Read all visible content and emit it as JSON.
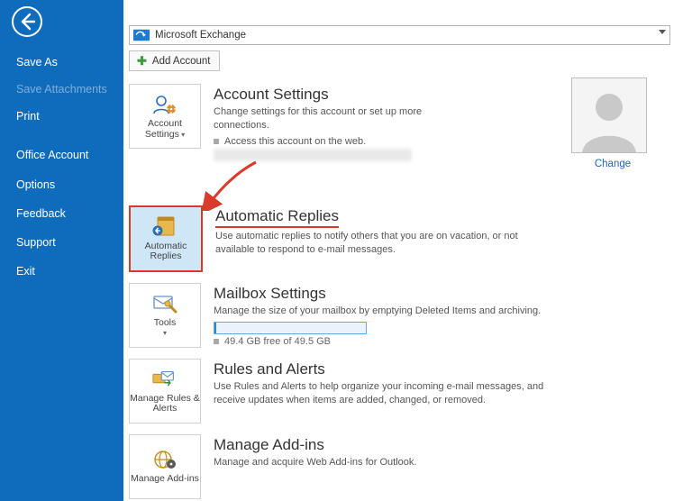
{
  "sidebar": {
    "items": [
      {
        "label": "Save As",
        "disabled": false
      },
      {
        "label": "Save Attachments",
        "disabled": true
      },
      {
        "label": "Print",
        "disabled": false
      }
    ],
    "items2": [
      {
        "label": "Office Account"
      },
      {
        "label": "Options"
      },
      {
        "label": "Feedback"
      },
      {
        "label": "Support"
      },
      {
        "label": "Exit"
      }
    ]
  },
  "account_selector": {
    "label": "Microsoft Exchange"
  },
  "add_account_btn": "Add Account",
  "avatar_change": "Change",
  "sections": {
    "account": {
      "tile_label": "Account Settings",
      "heading": "Account Settings",
      "desc": "Change settings for this account or set up more connections.",
      "sub": "Access this account on the web."
    },
    "auto": {
      "tile_label": "Automatic Replies",
      "heading": "Automatic Replies",
      "desc": "Use automatic replies to notify others that you are on vacation, or not available to respond to e-mail messages."
    },
    "mailbox": {
      "tile_label": "Tools",
      "heading": "Mailbox Settings",
      "desc": "Manage the size of your mailbox by emptying Deleted Items and archiving.",
      "storage_text": "49.4 GB free of 49.5 GB"
    },
    "rules": {
      "tile_label": "Manage Rules & Alerts",
      "heading": "Rules and Alerts",
      "desc": "Use Rules and Alerts to help organize your incoming e-mail messages, and receive updates when items are added, changed, or removed."
    },
    "addins": {
      "tile_label": "Manage Add-ins",
      "heading": "Manage Add-ins",
      "desc": "Manage and acquire Web Add-ins for Outlook."
    }
  }
}
